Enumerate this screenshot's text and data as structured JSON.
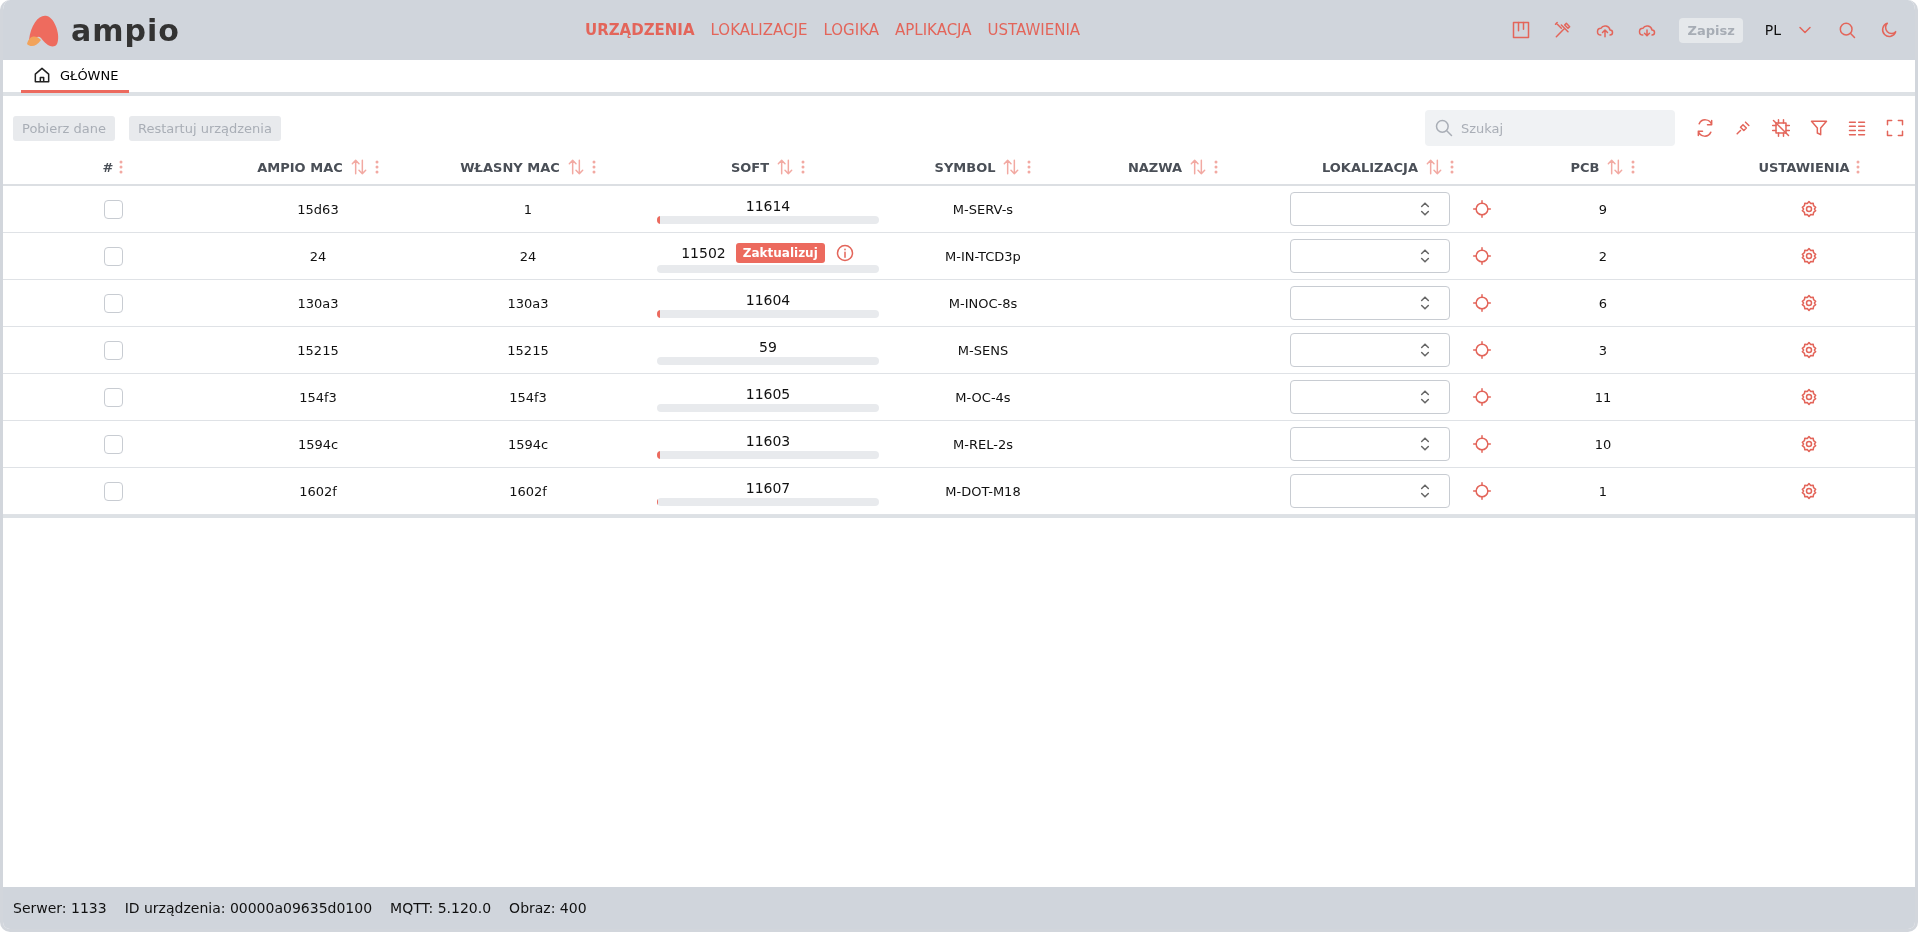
{
  "brand": {
    "logo_text": "ampio"
  },
  "nav": [
    {
      "label": "URZĄDZENIA",
      "selected": true
    },
    {
      "label": "LOKALIZACJE",
      "selected": false
    },
    {
      "label": "LOGIKA",
      "selected": false
    },
    {
      "label": "APLIKACJA",
      "selected": false
    },
    {
      "label": "USTAWIENIA",
      "selected": false
    }
  ],
  "header_actions": {
    "save_label": "Zapisz",
    "language": "PL"
  },
  "tabs": [
    {
      "label": "GŁÓWNE",
      "selected": true
    }
  ],
  "toolbar": {
    "buttons": [
      {
        "label": "Pobierz dane",
        "disabled": true
      },
      {
        "label": "Restartuj urządzenia",
        "disabled": true
      }
    ],
    "search": {
      "placeholder": "Szukaj"
    }
  },
  "table": {
    "columns": [
      {
        "label": "#",
        "sortable": false
      },
      {
        "label": "AMPIO MAC",
        "sortable": true
      },
      {
        "label": "WŁASNY MAC",
        "sortable": true
      },
      {
        "label": "SOFT",
        "sortable": true
      },
      {
        "label": "SYMBOL",
        "sortable": true
      },
      {
        "label": "NAZWA",
        "sortable": true
      },
      {
        "label": "LOKALIZACJA",
        "sortable": true
      },
      {
        "label": "PCB",
        "sortable": true
      },
      {
        "label": "USTAWIENIA",
        "sortable": false
      }
    ],
    "rows": [
      {
        "checked": false,
        "ampio_mac": "15d63",
        "own_mac": "1",
        "soft": {
          "version": "11614",
          "level": 0.015
        },
        "symbol": "M-SERV-s",
        "pcb": "9"
      },
      {
        "checked": false,
        "ampio_mac": "24",
        "own_mac": "24",
        "soft": {
          "version": "11502",
          "level": 0,
          "update_label": "Zaktualizuj"
        },
        "symbol": "M-IN-TCD3p",
        "pcb": "2"
      },
      {
        "checked": false,
        "ampio_mac": "130a3",
        "own_mac": "130a3",
        "soft": {
          "version": "11604",
          "level": 0.015
        },
        "symbol": "M-INOC-8s",
        "pcb": "6"
      },
      {
        "checked": false,
        "ampio_mac": "15215",
        "own_mac": "15215",
        "soft": {
          "version": "59",
          "level": 0
        },
        "symbol": "M-SENS",
        "pcb": "3"
      },
      {
        "checked": false,
        "ampio_mac": "154f3",
        "own_mac": "154f3",
        "soft": {
          "version": "11605",
          "level": 0
        },
        "symbol": "M-OC-4s",
        "pcb": "11"
      },
      {
        "checked": false,
        "ampio_mac": "1594c",
        "own_mac": "1594c",
        "soft": {
          "version": "11603",
          "level": 0.012
        },
        "symbol": "M-REL-2s",
        "pcb": "10"
      },
      {
        "checked": false,
        "ampio_mac": "1602f",
        "own_mac": "1602f",
        "soft": {
          "version": "11607",
          "level": 0.005
        },
        "symbol": "M-DOT-M18",
        "pcb": "1"
      }
    ]
  },
  "status_bar": [
    "Serwer: 1133",
    "ID urządzenia: 00000a09635d0100",
    "MQTT: 5.120.0",
    "Obraz: 400"
  ]
}
